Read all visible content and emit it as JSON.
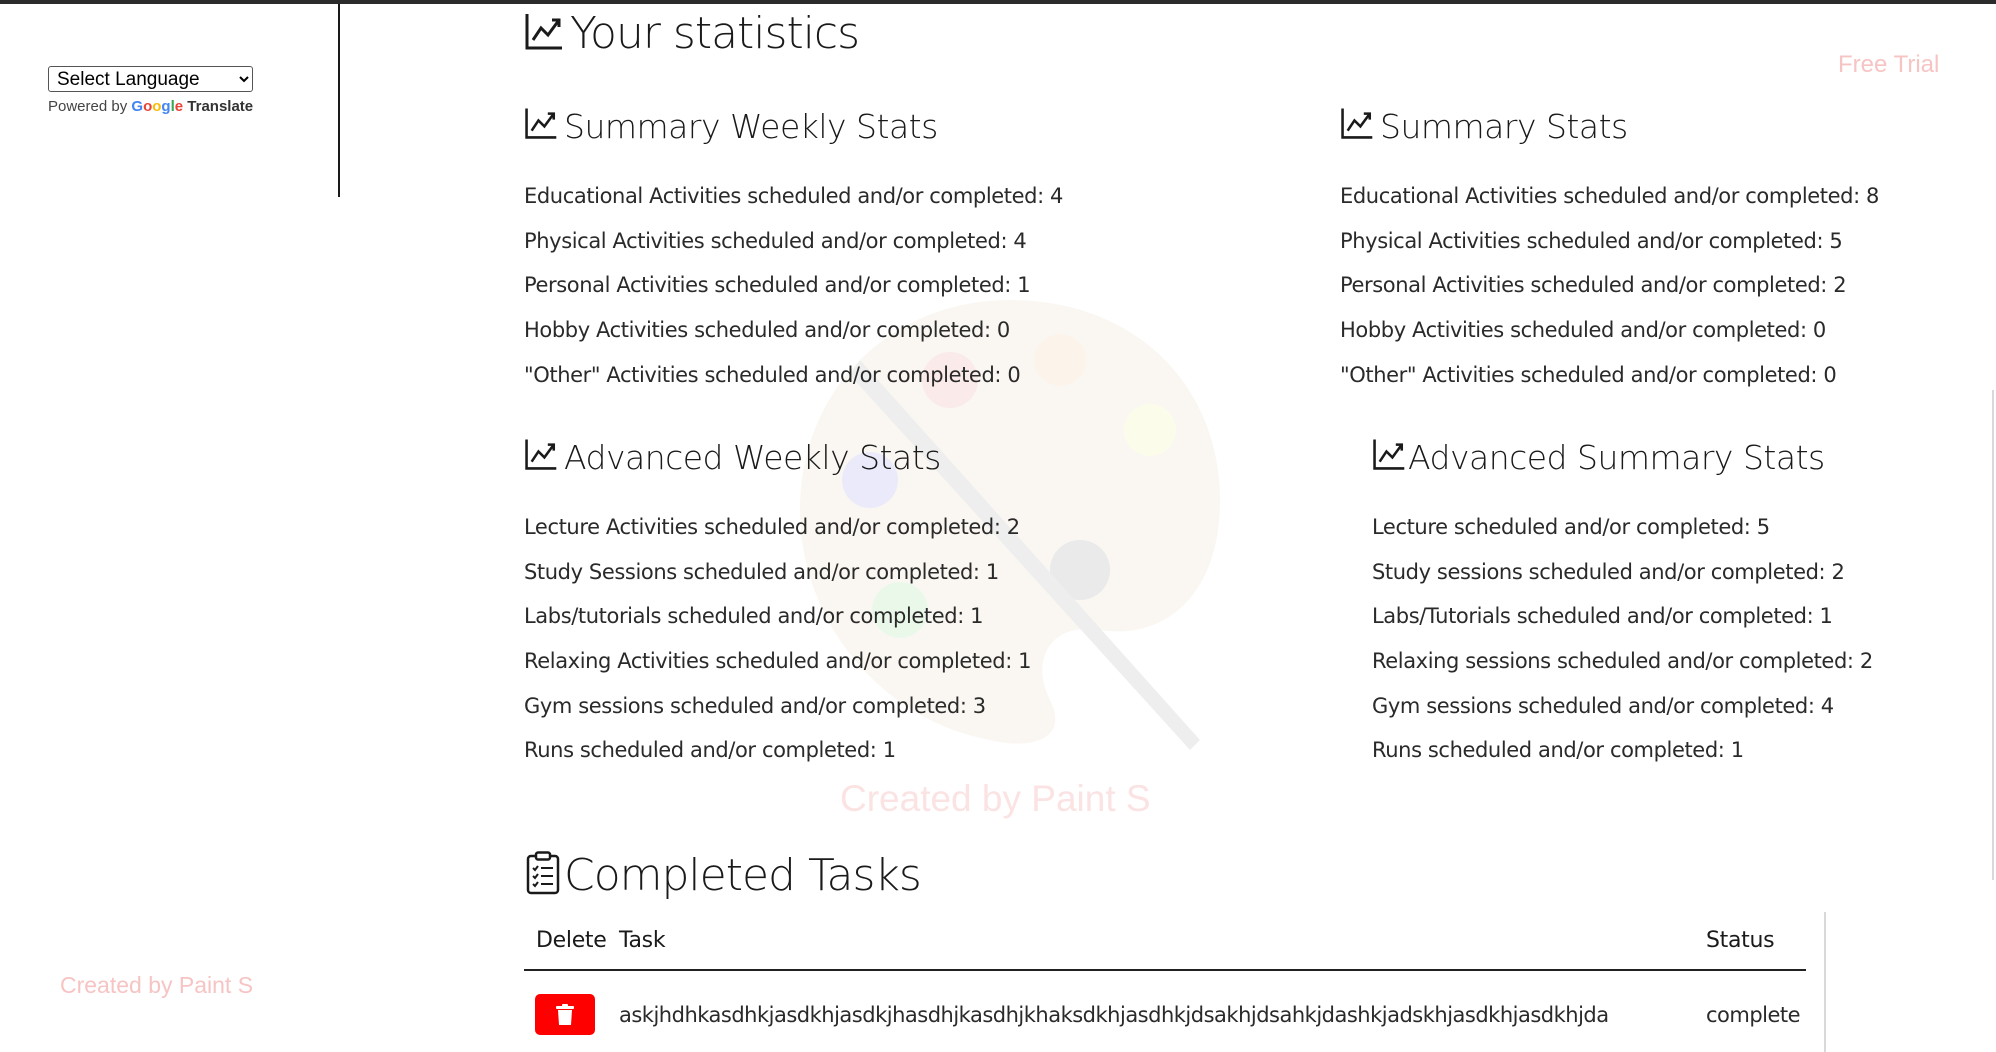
{
  "sidebar": {
    "language_select": "Select Language",
    "powered_by": "Powered by",
    "google_letters": [
      "G",
      "o",
      "o",
      "g",
      "l",
      "e"
    ],
    "translate": "Translate",
    "watermark": "Created by Paint S"
  },
  "header": {
    "free_trial": "Free Trial"
  },
  "page": {
    "title": "Your statistics",
    "center_watermark": "Created by Paint S"
  },
  "summary_weekly": {
    "title": "Summary Weekly Stats",
    "items": [
      "Educational Activities scheduled and/or completed: 4",
      "Physical Activities scheduled and/or completed: 4",
      "Personal Activities scheduled and/or completed: 1",
      "Hobby Activities scheduled and/or completed: 0",
      "\"Other\" Activities scheduled and/or completed: 0"
    ]
  },
  "summary_total": {
    "title": "Summary Stats",
    "items": [
      "Educational Activities scheduled and/or completed: 8",
      "Physical Activities scheduled and/or completed: 5",
      "Personal Activities scheduled and/or completed: 2",
      "Hobby Activities scheduled and/or completed: 0",
      "\"Other\" Activities scheduled and/or completed: 0"
    ]
  },
  "advanced_weekly": {
    "title": "Advanced Weekly Stats",
    "items": [
      "Lecture Activities scheduled and/or completed: 2",
      "Study Sessions scheduled and/or completed: 1",
      "Labs/tutorials scheduled and/or completed: 1",
      "Relaxing Activities scheduled and/or completed: 1",
      "Gym sessions scheduled and/or completed: 3",
      "Runs scheduled and/or completed: 1"
    ]
  },
  "advanced_total": {
    "title": "Advanced Summary Stats",
    "items": [
      "Lecture scheduled and/or completed: 5",
      "Study sessions scheduled and/or completed: 2",
      "Labs/Tutorials scheduled and/or completed: 1",
      "Relaxing sessions scheduled and/or completed: 2",
      "Gym sessions scheduled and/or completed: 4",
      "Runs scheduled and/or completed: 1"
    ]
  },
  "completed_tasks": {
    "title": "Completed Tasks",
    "columns": {
      "delete": "Delete",
      "task": "Task",
      "status": "Status"
    },
    "rows": [
      {
        "task": "askjhdhkasdhkjasdkhjasdkjhasdhjkasdhjkhaksdkhjasdhkjdsakhjdsahkjdashkjadskhjasdkhjasdkhjda",
        "status": "complete"
      }
    ]
  },
  "colors": {
    "delete_button": "#ff0000",
    "watermark": "#f7c4c4",
    "text": "#1a1a1a"
  },
  "icons": {
    "stats_heading": "trend-chart-icon",
    "tasks_heading": "clipboard-checklist-icon",
    "delete_button": "trash-icon",
    "select_caret": "chevron-down-icon"
  }
}
